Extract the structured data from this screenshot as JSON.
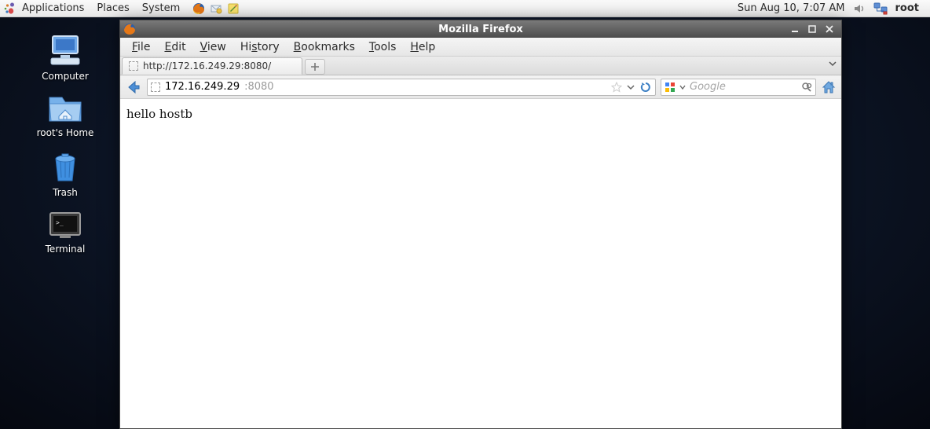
{
  "panel": {
    "menus": {
      "applications": "Applications",
      "places": "Places",
      "system": "System"
    },
    "clock": "Sun Aug 10,  7:07 AM",
    "user": "root"
  },
  "desktop": {
    "computer": "Computer",
    "home": "root's Home",
    "trash": "Trash",
    "terminal": "Terminal"
  },
  "window": {
    "title": "Mozilla Firefox",
    "menubar": {
      "file": "File",
      "edit": "Edit",
      "view": "View",
      "history": "History",
      "bookmarks": "Bookmarks",
      "tools": "Tools",
      "help": "Help"
    },
    "tab": {
      "label": "http://172.16.249.29:8080/"
    },
    "url": {
      "host": "172.16.249.29",
      "port": ":8080"
    },
    "search": {
      "placeholder": "Google"
    },
    "page": {
      "body": "hello hostb"
    }
  }
}
